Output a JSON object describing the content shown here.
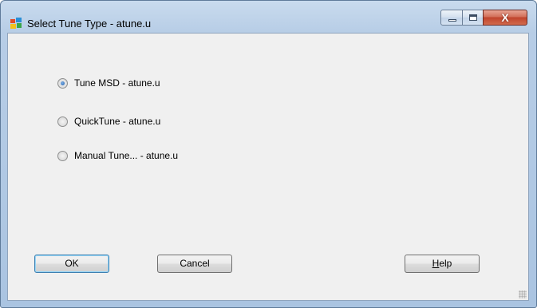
{
  "window": {
    "title": "Select Tune Type - atune.u",
    "close_label": "X"
  },
  "options": [
    {
      "label": "Tune MSD - atune.u",
      "checked": true
    },
    {
      "label": "QuickTune - atune.u",
      "checked": false
    },
    {
      "label": "Manual Tune... - atune.u",
      "checked": false
    }
  ],
  "buttons": {
    "ok": "OK",
    "cancel": "Cancel",
    "help_rest": "elp",
    "help_mnemonic": "H"
  },
  "icons": [
    "app-icon",
    "minimize-icon",
    "maximize-icon",
    "close-icon",
    "radio-icon",
    "resize-grip-icon"
  ]
}
